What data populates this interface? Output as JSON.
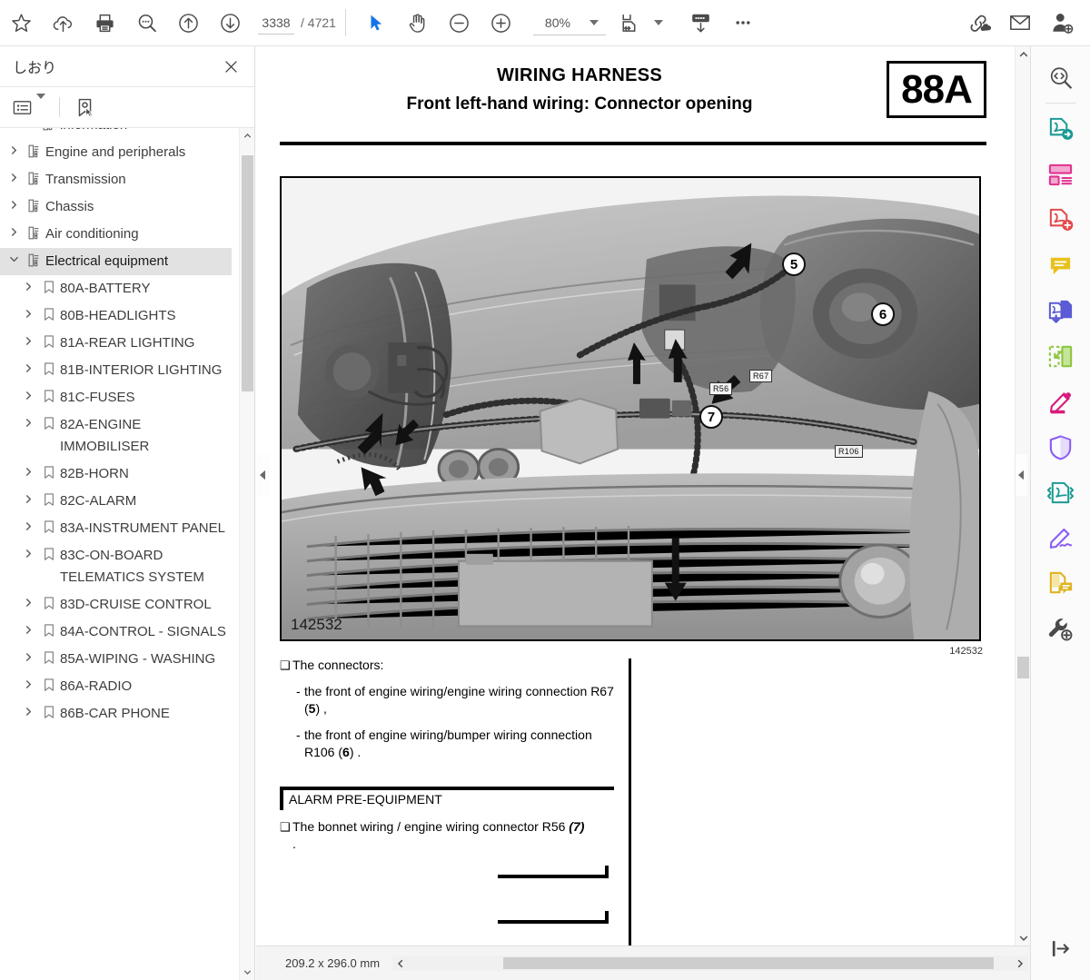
{
  "toolbar": {
    "buttons": [
      {
        "name": "bookmark-star-icon",
        "label": "Star"
      },
      {
        "name": "cloud-upload-icon",
        "label": "Upload to cloud"
      },
      {
        "name": "print-icon",
        "label": "Print"
      },
      {
        "name": "search-comment-icon",
        "label": "Search"
      },
      {
        "name": "previous-page-icon",
        "label": "Previous page"
      },
      {
        "name": "next-page-icon",
        "label": "Next page"
      }
    ],
    "page_current": "3338",
    "page_total": "/ 4721",
    "select_tool": "Select",
    "hand_tool": "Pan",
    "zoom_out": "Zoom out",
    "zoom_in": "Zoom in",
    "zoom_value": "80%",
    "fit_page_label": "Fit page",
    "export_label": "Export",
    "more_label": "More",
    "link_cloud_label": "Share link",
    "mail_label": "Email",
    "add_user_label": "Add user"
  },
  "sidebar": {
    "title": "しおり",
    "close_label": "×",
    "options_label": "Bookmark options",
    "new_bookmark_label": "New bookmark",
    "tree": [
      {
        "label": "information",
        "level": 2,
        "expander": "none",
        "icon": "folder-tree-icon",
        "selected": false,
        "clipped": true
      },
      {
        "label": "Engine and peripherals",
        "level": 1,
        "expander": "collapsed",
        "icon": "folder-tree-icon",
        "selected": false
      },
      {
        "label": "Transmission",
        "level": 1,
        "expander": "collapsed",
        "icon": "folder-tree-icon",
        "selected": false
      },
      {
        "label": "Chassis",
        "level": 1,
        "expander": "collapsed",
        "icon": "folder-tree-icon",
        "selected": false
      },
      {
        "label": "Air conditioning",
        "level": 1,
        "expander": "collapsed",
        "icon": "folder-tree-icon",
        "selected": false
      },
      {
        "label": "Electrical equipment",
        "level": 1,
        "expander": "expanded",
        "icon": "folder-tree-icon",
        "selected": true
      },
      {
        "label": "80A-BATTERY",
        "level": 2,
        "expander": "collapsed",
        "icon": "bookmark-icon",
        "selected": false
      },
      {
        "label": "80B-HEADLIGHTS",
        "level": 2,
        "expander": "collapsed",
        "icon": "bookmark-icon",
        "selected": false
      },
      {
        "label": "81A-REAR LIGHTING",
        "level": 2,
        "expander": "collapsed",
        "icon": "bookmark-icon",
        "selected": false
      },
      {
        "label": "81B-INTERIOR LIGHTING",
        "level": 2,
        "expander": "collapsed",
        "icon": "bookmark-icon",
        "selected": false
      },
      {
        "label": "81C-FUSES",
        "level": 2,
        "expander": "collapsed",
        "icon": "bookmark-icon",
        "selected": false
      },
      {
        "label": "82A-ENGINE IMMOBILISER",
        "level": 2,
        "expander": "collapsed",
        "icon": "bookmark-icon",
        "selected": false
      },
      {
        "label": "82B-HORN",
        "level": 2,
        "expander": "collapsed",
        "icon": "bookmark-icon",
        "selected": false
      },
      {
        "label": "82C-ALARM",
        "level": 2,
        "expander": "collapsed",
        "icon": "bookmark-icon",
        "selected": false
      },
      {
        "label": "83A-INSTRUMENT PANEL",
        "level": 2,
        "expander": "collapsed",
        "icon": "bookmark-icon",
        "selected": false
      },
      {
        "label": "83C-ON-BOARD TELEMATICS SYSTEM",
        "level": 2,
        "expander": "collapsed",
        "icon": "bookmark-icon",
        "selected": false
      },
      {
        "label": "83D-CRUISE CONTROL",
        "level": 2,
        "expander": "collapsed",
        "icon": "bookmark-icon",
        "selected": false
      },
      {
        "label": "84A-CONTROL - SIGNALS",
        "level": 2,
        "expander": "collapsed",
        "icon": "bookmark-icon",
        "selected": false
      },
      {
        "label": "85A-WIPING - WASHING",
        "level": 2,
        "expander": "collapsed",
        "icon": "bookmark-icon",
        "selected": false
      },
      {
        "label": "86A-RADIO",
        "level": 2,
        "expander": "collapsed",
        "icon": "bookmark-icon",
        "selected": false
      },
      {
        "label": "86B-CAR PHONE",
        "level": 2,
        "expander": "collapsed",
        "icon": "bookmark-icon",
        "selected": false
      }
    ]
  },
  "document": {
    "title_line1": "WIRING HARNESS",
    "title_line2": "Front left-hand wiring: Connector opening",
    "section_code": "88A",
    "figure_id_inside": "142532",
    "figure_id_outside": "142532",
    "callouts": [
      {
        "number": "5"
      },
      {
        "number": "6"
      },
      {
        "number": "7"
      }
    ],
    "connector_tags": [
      {
        "label": "R56"
      },
      {
        "label": "R67"
      },
      {
        "label": "R106"
      }
    ],
    "body": {
      "intro_bullet": "The connectors:",
      "items": [
        {
          "text_before": "the front of engine wiring/engine wiring connection R67 (",
          "bold": "5",
          "text_after": ") ,"
        },
        {
          "text_before": "the front of engine wiring/bumper wiring connection R106 (",
          "bold": "6",
          "text_after": ") ."
        }
      ],
      "alarm_heading": "ALARM PRE-EQUIPMENT",
      "alarm_bullet_before": "The bonnet wiring / engine wiring connector R56 ",
      "alarm_bullet_italic": "(7)",
      "alarm_bullet_after": "."
    }
  },
  "statusbar": {
    "page_size": "209.2 x 296.0 mm",
    "scroll_left_label": "Scroll left",
    "scroll_right_label": "Scroll right"
  },
  "rail": {
    "buttons": [
      {
        "name": "search-document-icon",
        "label": "Search document"
      },
      {
        "name": "export-pdf-icon",
        "label": "Export PDF"
      },
      {
        "name": "organize-pages-icon",
        "label": "Organize pages"
      },
      {
        "name": "create-pdf-icon",
        "label": "Create PDF"
      },
      {
        "name": "comment-icon",
        "label": "Comment"
      },
      {
        "name": "combine-files-icon",
        "label": "Combine files"
      },
      {
        "name": "crop-pages-icon",
        "label": "Crop pages"
      },
      {
        "name": "highlight-icon",
        "label": "Highlight"
      },
      {
        "name": "protect-icon",
        "label": "Protect"
      },
      {
        "name": "compress-pdf-icon",
        "label": "Compress PDF"
      },
      {
        "name": "fill-sign-icon",
        "label": "Fill & Sign"
      },
      {
        "name": "stamp-comment-icon",
        "label": "Stamp"
      },
      {
        "name": "more-tools-icon",
        "label": "More tools"
      }
    ],
    "collapse_label": "Collapse panel"
  },
  "colors": {
    "accent_blue": "#1473e6",
    "teal": "#29a19c",
    "pink": "#e1318f",
    "red": "#e34a4a",
    "yellow": "#e8c11c",
    "indigo": "#5b5bd6",
    "green": "#8cc63f",
    "magenta": "#d81b7c",
    "purple": "#8b5cf6",
    "gold": "#e0b420"
  }
}
